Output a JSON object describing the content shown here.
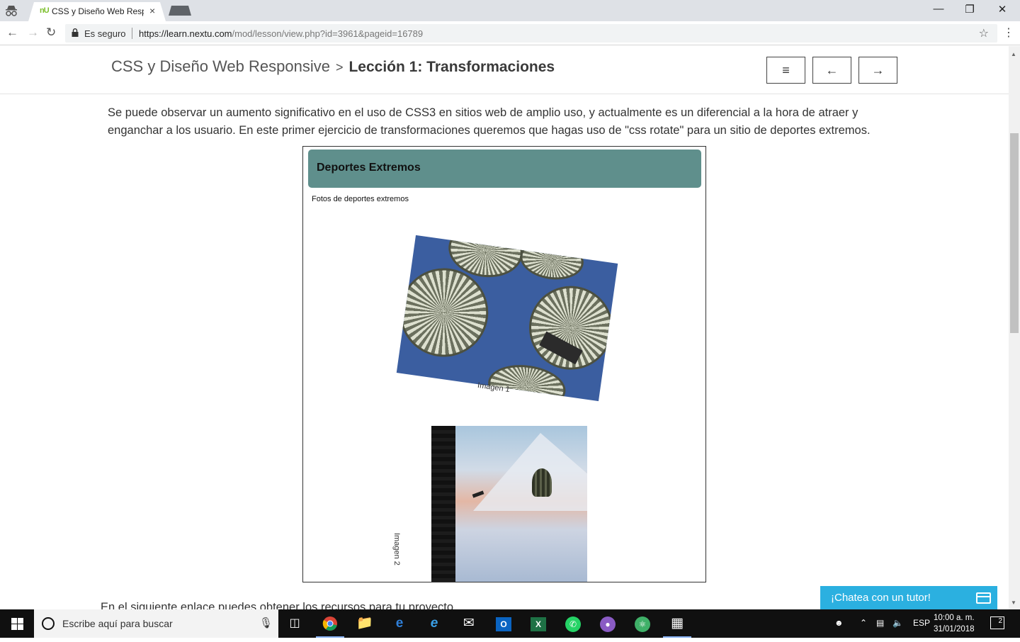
{
  "browser": {
    "tab_favicon": "nU",
    "tab_title": "CSS y Diseño Web Respo",
    "tab_close": "×",
    "security_label": "Es seguro",
    "url_host": "https://learn.nextu.com",
    "url_path": "/mod/lesson/view.php?id=3961&pageid=16789",
    "back_icon": "arrow-left-icon",
    "forward_icon": "arrow-right-icon",
    "reload_icon": "reload-icon"
  },
  "header": {
    "course": "CSS y Diseño Web Responsive",
    "separator": ">",
    "lesson": "Lección 1: Transformaciones",
    "menu_icon": "≡",
    "prev_icon": "←",
    "next_icon": "→"
  },
  "content": {
    "intro": "Se puede observar un aumento significativo en el uso de CSS3 en sitios web de amplio uso, y actualmente es un diferencial a la hora de atraer y enganchar a los usuario. En este primer ejercicio de transformaciones queremos que hagas uso de \"css rotate\" para un sitio de deportes extremos.",
    "demo_title": "Deportes Extremos",
    "demo_subtitle": "Fotos de deportes extremos",
    "caption1": "Imagen 1",
    "caption2": "Imagen 2",
    "image1_rotation_deg": 8,
    "image2_rotation_deg": 90,
    "below_text": "En el siguiente enlace puedes obtener los recursos para tu proyecto."
  },
  "chat": {
    "label": "¡Chatea con un tutor!"
  },
  "taskbar": {
    "search_placeholder": "Escribe aquí para buscar",
    "language": "ESP",
    "time": "10:00 a. m.",
    "date": "31/01/2018",
    "notifications": "2"
  },
  "colors": {
    "demo_header": "#5f8f8c",
    "chat_button": "#2bb0e0",
    "taskbar": "#101010"
  }
}
